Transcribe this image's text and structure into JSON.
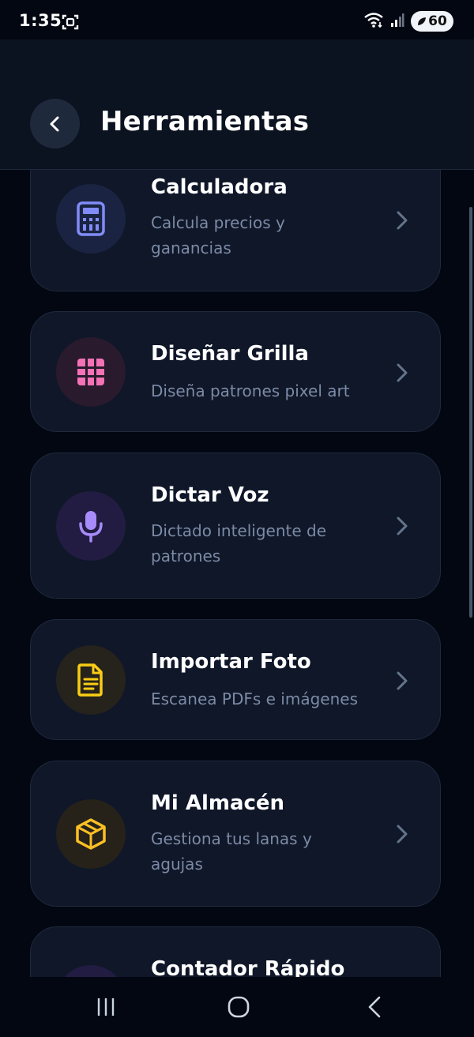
{
  "status_bar": {
    "time": "1:35",
    "battery": "60"
  },
  "header": {
    "title": "Herramientas",
    "back_icon": "chevron-left-icon"
  },
  "tools": [
    {
      "title": "Calculadora",
      "description": "Calcula precios y ganancias",
      "icon": "calculator-icon",
      "icon_color": "#818cf8",
      "icon_bg": "#1a2442"
    },
    {
      "title": "Diseñar Grilla",
      "description": "Diseña patrones pixel art",
      "icon": "grid-icon",
      "icon_color": "#f472b6",
      "icon_bg": "#2a1a2e"
    },
    {
      "title": "Dictar Voz",
      "description": "Dictado inteligente de patrones",
      "icon": "microphone-icon",
      "icon_color": "#a78bfa",
      "icon_bg": "#221c42"
    },
    {
      "title": "Importar Foto",
      "description": "Escanea PDFs e imágenes",
      "icon": "document-icon",
      "icon_color": "#facc15",
      "icon_bg": "#25231c"
    },
    {
      "title": "Mi Almacén",
      "description": "Gestiona tus lanas y agujas",
      "icon": "box-icon",
      "icon_color": "#fbbf24",
      "icon_bg": "#26221a"
    },
    {
      "title": "Contador Rápido",
      "description": "",
      "icon": "counter-icon",
      "icon_color": "#a78bfa",
      "icon_bg": "#221c42"
    }
  ],
  "colors": {
    "background": "#030712",
    "card": "#0f1729",
    "header": "#0b1220",
    "muted_text": "#7c8aa5"
  }
}
